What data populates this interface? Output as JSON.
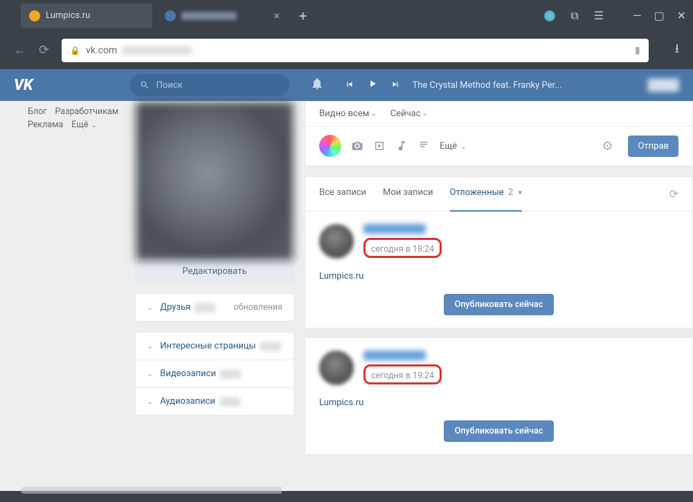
{
  "browser": {
    "tabs": [
      {
        "title": "Lumpics.ru",
        "active": false,
        "favicon": "#f5a623"
      },
      {
        "title": "",
        "active": true,
        "favicon": "#4a76a8"
      }
    ],
    "address": "vk.com"
  },
  "vk_header": {
    "search_placeholder": "Поиск",
    "now_playing": "The Crystal Method feat. Franky Per..."
  },
  "left_links": {
    "row1": [
      "Блог",
      "Разработчикам"
    ],
    "row2": [
      "Реклама",
      "Ещё"
    ]
  },
  "profile": {
    "edit": "Редактировать"
  },
  "side_blocks": {
    "friends": "Друзья",
    "updates": "обновления",
    "interesting": "Интересные страницы",
    "videos": "Видеозаписи",
    "audio": "Аудиозаписи"
  },
  "composer": {
    "visibility": "Видно всем",
    "when": "Сейчас",
    "more": "Ещё",
    "send": "Отправ"
  },
  "wall_tabs": {
    "all": "Все записи",
    "mine": "Мои записи",
    "scheduled": "Отложенные",
    "scheduled_count": "2"
  },
  "posts": [
    {
      "time": "сегодня в 18:24",
      "link": "Lumpics.ru",
      "publish": "Опубликовать сейчас"
    },
    {
      "time": "сегодня в 19:24",
      "link": "Lumpics.ru",
      "publish": "Опубликовать сейчас"
    }
  ]
}
